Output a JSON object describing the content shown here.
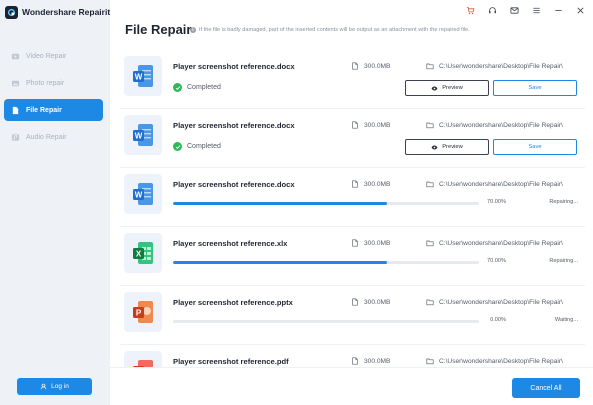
{
  "app": {
    "name": "Wondershare Repairit"
  },
  "sidebar": {
    "items": [
      {
        "label": "Video Repair",
        "icon": "video-icon",
        "active": false
      },
      {
        "label": "Photo repair",
        "icon": "photo-icon",
        "active": false
      },
      {
        "label": "File Repair",
        "icon": "file-icon",
        "active": true
      },
      {
        "label": "Audio Repair",
        "icon": "audio-icon",
        "active": false
      }
    ],
    "login_label": "Log in"
  },
  "header": {
    "title": "File Repair",
    "info": "If the file is badly damaged, part of the inserted contents will be output as an attachment with the repaired file."
  },
  "files": [
    {
      "name": "Player screenshot reference.docx",
      "type": "word",
      "size": "300.0MB",
      "path": "C:\\User\\wondershare\\Desktop\\File Repair\\",
      "status": "Completed",
      "preview_label": "Preview",
      "save_label": "Save"
    },
    {
      "name": "Player screenshot reference.docx",
      "type": "word",
      "size": "300.0MB",
      "path": "C:\\User\\wondershare\\Desktop\\File Repair\\",
      "status": "Completed",
      "preview_label": "Preview",
      "save_label": "Save"
    },
    {
      "name": "Player screenshot reference.docx",
      "type": "word",
      "size": "300.0MB",
      "path": "C:\\User\\wondershare\\Desktop\\File Repair\\",
      "progress_label": "70.00%",
      "progress": 0.7,
      "state": "Repairing..."
    },
    {
      "name": "Player screenshot reference.xlx",
      "type": "excel",
      "size": "300.0MB",
      "path": "C:\\User\\wondershare\\Desktop\\File Repair\\",
      "progress_label": "70.00%",
      "progress": 0.7,
      "state": "Repairing..."
    },
    {
      "name": "Player screenshot reference.pptx",
      "type": "powerpoint",
      "size": "300.0MB",
      "path": "C:\\User\\wondershare\\Desktop\\File Repair\\",
      "progress_label": "0.00%",
      "progress": 0,
      "state": "Waiting..."
    },
    {
      "name": "Player screenshot reference.pdf",
      "type": "pdf",
      "size": "300.0MB",
      "path": "C:\\User\\wondershare\\Desktop\\File Repair\\"
    }
  ],
  "footer": {
    "cancel_all_label": "Cancel All"
  },
  "colors": {
    "accent": "#1e88e5",
    "success": "#2eb85c",
    "word": "#2b7cd3",
    "excel": "#21a366",
    "powerpoint": "#d35230",
    "pdf": "#e5483a"
  }
}
